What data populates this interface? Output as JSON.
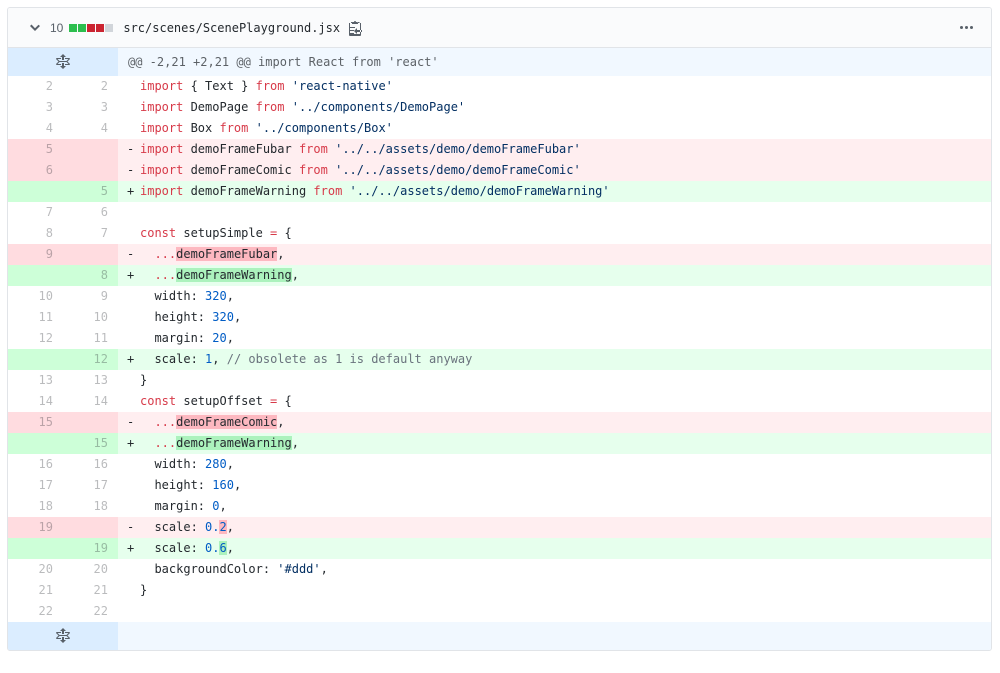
{
  "file": {
    "changes_count": "10",
    "diffstat": [
      "add",
      "add",
      "del",
      "del",
      "neutral"
    ],
    "path": "src/scenes/ScenePlayground.jsx"
  },
  "colors": {
    "addition_square": "#2cbe4e",
    "deletion_square": "#cb2431",
    "neutral_square": "#d1d5da",
    "addition_line_bg": "#e6ffed",
    "addition_gutter_bg": "#cdffd8",
    "addition_word_bg": "#acf2bd",
    "deletion_line_bg": "#ffeef0",
    "deletion_gutter_bg": "#ffdce0",
    "deletion_word_bg": "#fdb8c0",
    "hunk_line_bg": "#f1f8ff",
    "hunk_gutter_bg": "#dbedff",
    "keyword": "#d73a49",
    "string": "#032f62",
    "number": "#005cc5",
    "comment": "#6a737d"
  },
  "diff": {
    "rows": [
      {
        "type": "hunk",
        "text": "@@ -2,21 +2,21 @@ import React from 'react'"
      },
      {
        "type": "context",
        "old": "2",
        "new": "2",
        "code": [
          [
            "k",
            "import"
          ],
          [
            "p",
            " { Text } "
          ],
          [
            "k",
            "from"
          ],
          [
            "p",
            " "
          ],
          [
            "s",
            "'react-native'"
          ]
        ]
      },
      {
        "type": "context",
        "old": "3",
        "new": "3",
        "code": [
          [
            "k",
            "import"
          ],
          [
            "p",
            " DemoPage "
          ],
          [
            "k",
            "from"
          ],
          [
            "p",
            " "
          ],
          [
            "s",
            "'../components/DemoPage'"
          ]
        ]
      },
      {
        "type": "context",
        "old": "4",
        "new": "4",
        "code": [
          [
            "k",
            "import"
          ],
          [
            "p",
            " Box "
          ],
          [
            "k",
            "from"
          ],
          [
            "p",
            " "
          ],
          [
            "s",
            "'../components/Box'"
          ]
        ]
      },
      {
        "type": "del",
        "old": "5",
        "new": "",
        "code": [
          [
            "k",
            "import"
          ],
          [
            "p",
            " demoFrameFubar "
          ],
          [
            "k",
            "from"
          ],
          [
            "p",
            " "
          ],
          [
            "s",
            "'../../assets/demo/demoFrameFubar'"
          ]
        ]
      },
      {
        "type": "del",
        "old": "6",
        "new": "",
        "code": [
          [
            "k",
            "import"
          ],
          [
            "p",
            " demoFrameComic "
          ],
          [
            "k",
            "from"
          ],
          [
            "p",
            " "
          ],
          [
            "s",
            "'../../assets/demo/demoFrameComic'"
          ]
        ]
      },
      {
        "type": "add",
        "old": "",
        "new": "5",
        "code": [
          [
            "k",
            "import"
          ],
          [
            "p",
            " demoFrameWarning "
          ],
          [
            "k",
            "from"
          ],
          [
            "p",
            " "
          ],
          [
            "s",
            "'../../assets/demo/demoFrameWarning'"
          ]
        ]
      },
      {
        "type": "context",
        "old": "7",
        "new": "6",
        "code": []
      },
      {
        "type": "context",
        "old": "8",
        "new": "7",
        "code": [
          [
            "k",
            "const"
          ],
          [
            "p",
            " setupSimple "
          ],
          [
            "k",
            "="
          ],
          [
            "p",
            " {"
          ]
        ]
      },
      {
        "type": "del",
        "old": "9",
        "new": "",
        "code": [
          [
            "p",
            "  "
          ],
          [
            "k",
            "..."
          ],
          [
            "wd",
            "demoFrameFubar"
          ],
          [
            "p",
            ","
          ]
        ]
      },
      {
        "type": "add",
        "old": "",
        "new": "8",
        "code": [
          [
            "p",
            "  "
          ],
          [
            "k",
            "..."
          ],
          [
            "wa",
            "demoFrameWarning"
          ],
          [
            "p",
            ","
          ]
        ]
      },
      {
        "type": "context",
        "old": "10",
        "new": "9",
        "code": [
          [
            "p",
            "  width: "
          ],
          [
            "n",
            "320"
          ],
          [
            "p",
            ","
          ]
        ]
      },
      {
        "type": "context",
        "old": "11",
        "new": "10",
        "code": [
          [
            "p",
            "  height: "
          ],
          [
            "n",
            "320"
          ],
          [
            "p",
            ","
          ]
        ]
      },
      {
        "type": "context",
        "old": "12",
        "new": "11",
        "code": [
          [
            "p",
            "  margin: "
          ],
          [
            "n",
            "20"
          ],
          [
            "p",
            ","
          ]
        ]
      },
      {
        "type": "add",
        "old": "",
        "new": "12",
        "code": [
          [
            "p",
            "  scale: "
          ],
          [
            "n",
            "1"
          ],
          [
            "p",
            ", "
          ],
          [
            "c",
            "// obsolete as 1 is default anyway"
          ]
        ]
      },
      {
        "type": "context",
        "old": "13",
        "new": "13",
        "code": [
          [
            "p",
            "}"
          ]
        ]
      },
      {
        "type": "context",
        "old": "14",
        "new": "14",
        "code": [
          [
            "k",
            "const"
          ],
          [
            "p",
            " setupOffset "
          ],
          [
            "k",
            "="
          ],
          [
            "p",
            " {"
          ]
        ]
      },
      {
        "type": "del",
        "old": "15",
        "new": "",
        "code": [
          [
            "p",
            "  "
          ],
          [
            "k",
            "..."
          ],
          [
            "wd",
            "demoFrameComic"
          ],
          [
            "p",
            ","
          ]
        ]
      },
      {
        "type": "add",
        "old": "",
        "new": "15",
        "code": [
          [
            "p",
            "  "
          ],
          [
            "k",
            "..."
          ],
          [
            "wa",
            "demoFrameWarning"
          ],
          [
            "p",
            ","
          ]
        ]
      },
      {
        "type": "context",
        "old": "16",
        "new": "16",
        "code": [
          [
            "p",
            "  width: "
          ],
          [
            "n",
            "280"
          ],
          [
            "p",
            ","
          ]
        ]
      },
      {
        "type": "context",
        "old": "17",
        "new": "17",
        "code": [
          [
            "p",
            "  height: "
          ],
          [
            "n",
            "160"
          ],
          [
            "p",
            ","
          ]
        ]
      },
      {
        "type": "context",
        "old": "18",
        "new": "18",
        "code": [
          [
            "p",
            "  margin: "
          ],
          [
            "n",
            "0"
          ],
          [
            "p",
            ","
          ]
        ]
      },
      {
        "type": "del",
        "old": "19",
        "new": "",
        "code": [
          [
            "p",
            "  scale: "
          ],
          [
            "n",
            "0."
          ],
          [
            "n wd",
            "2"
          ],
          [
            "p",
            ","
          ]
        ]
      },
      {
        "type": "add",
        "old": "",
        "new": "19",
        "code": [
          [
            "p",
            "  scale: "
          ],
          [
            "n",
            "0."
          ],
          [
            "n wa",
            "6"
          ],
          [
            "p",
            ","
          ]
        ]
      },
      {
        "type": "context",
        "old": "20",
        "new": "20",
        "code": [
          [
            "p",
            "  backgroundColor: "
          ],
          [
            "s",
            "'#ddd'"
          ],
          [
            "p",
            ","
          ]
        ]
      },
      {
        "type": "context",
        "old": "21",
        "new": "21",
        "code": [
          [
            "p",
            "}"
          ]
        ]
      },
      {
        "type": "context",
        "old": "22",
        "new": "22",
        "code": []
      },
      {
        "type": "expand",
        "text": ""
      }
    ]
  }
}
